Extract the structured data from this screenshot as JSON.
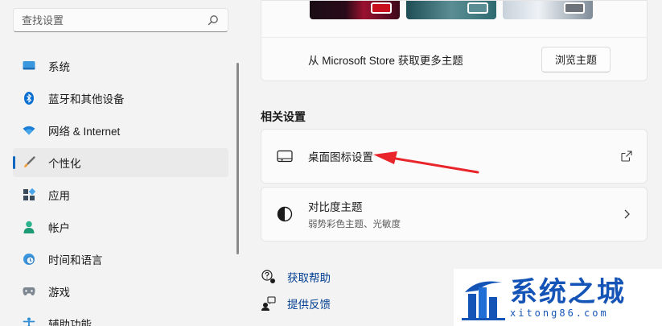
{
  "sidebar": {
    "search_placeholder": "查找设置",
    "items": [
      {
        "label": "系统",
        "icon": "monitor-icon"
      },
      {
        "label": "蓝牙和其他设备",
        "icon": "bluetooth-icon"
      },
      {
        "label": "网络 & Internet",
        "icon": "wifi-icon"
      },
      {
        "label": "个性化",
        "icon": "brush-icon",
        "active": true
      },
      {
        "label": "应用",
        "icon": "apps-icon"
      },
      {
        "label": "帐户",
        "icon": "person-icon"
      },
      {
        "label": "时间和语言",
        "icon": "globe-clock-icon"
      },
      {
        "label": "游戏",
        "icon": "gamepad-icon"
      },
      {
        "label": "辅助功能",
        "icon": "accessibility-icon"
      }
    ]
  },
  "main": {
    "store_text": "从 Microsoft Store 获取更多主题",
    "browse_button": "浏览主题",
    "related_title": "相关设置",
    "desktop_icons_title": "桌面图标设置",
    "contrast_title": "对比度主题",
    "contrast_subtitle": "弱势彩色主题、光敏度",
    "help_link": "获取帮助",
    "feedback_link": "提供反馈"
  },
  "watermark": {
    "text": "系统之城",
    "url": "xitong86.com"
  },
  "colors": {
    "accent": "#0067c0",
    "link": "#003e92",
    "arrow": "#e8252a",
    "watermark": "#1554b7"
  }
}
